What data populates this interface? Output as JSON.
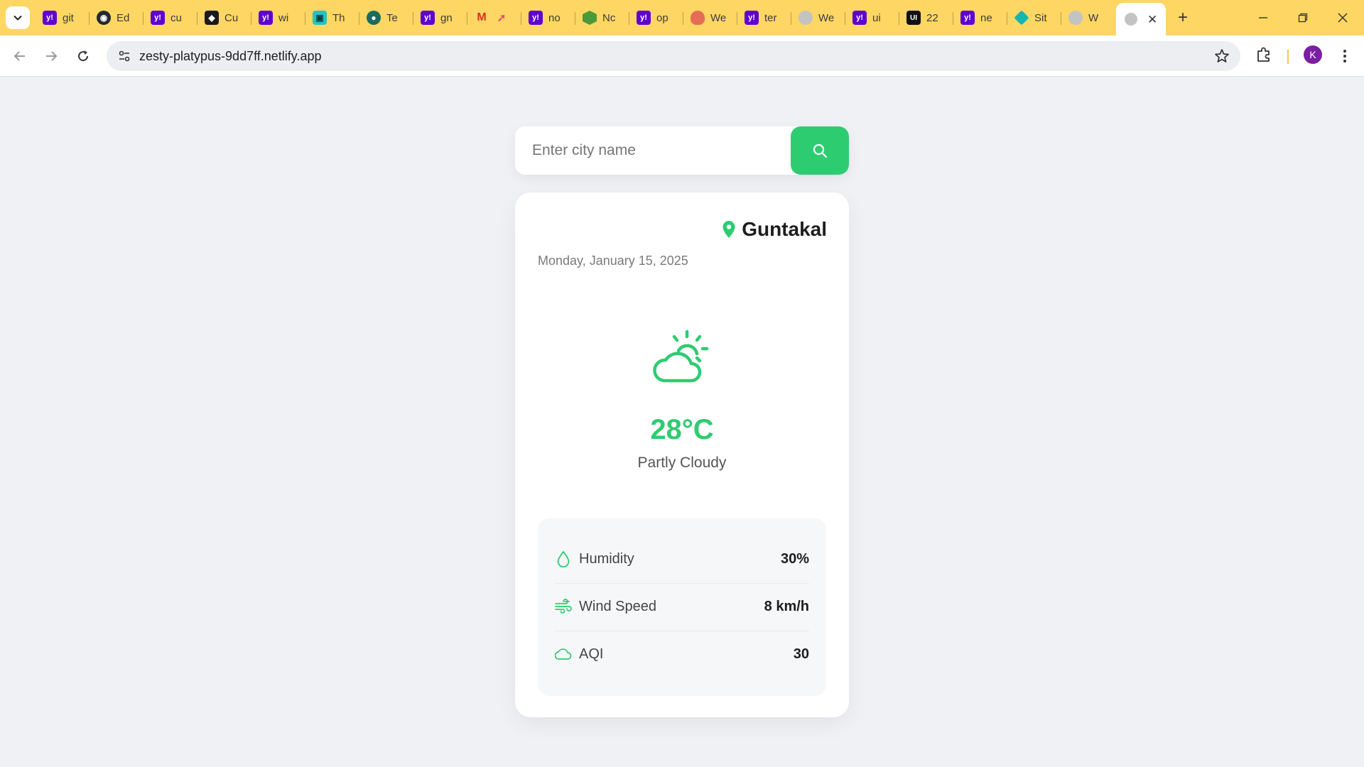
{
  "browser": {
    "tabs": [
      {
        "icon": "yahoo-icon",
        "label": "git"
      },
      {
        "icon": "github-icon",
        "label": "Ed"
      },
      {
        "icon": "yahoo-icon",
        "label": "cu"
      },
      {
        "icon": "cursor-icon",
        "label": "Cu"
      },
      {
        "icon": "yahoo-icon",
        "label": "wi"
      },
      {
        "icon": "trae-icon",
        "label": "Th"
      },
      {
        "icon": "terra-icon",
        "label": "Te"
      },
      {
        "icon": "yahoo-icon",
        "label": "gn"
      },
      {
        "icon": "gmail-icon",
        "label": ""
      },
      {
        "icon": "yahoo-icon",
        "label": "no"
      },
      {
        "icon": "node-icon",
        "label": "Nc"
      },
      {
        "icon": "yahoo-icon",
        "label": "op"
      },
      {
        "icon": "cloud-favicon-icon",
        "label": "We"
      },
      {
        "icon": "yahoo-icon",
        "label": "ter"
      },
      {
        "icon": "globe-icon",
        "label": "We"
      },
      {
        "icon": "yahoo-icon",
        "label": "ui"
      },
      {
        "icon": "uiverse-icon",
        "label": "22"
      },
      {
        "icon": "yahoo-icon",
        "label": "ne"
      },
      {
        "icon": "diamond-icon",
        "label": "Sit"
      },
      {
        "icon": "globe-icon",
        "label": "W"
      }
    ],
    "url": "zesty-platypus-9dd7ff.netlify.app",
    "profile_initial": "K",
    "tab_bar_color": "#fdd663"
  },
  "app": {
    "search": {
      "placeholder": "Enter city name",
      "value": ""
    },
    "location": {
      "city": "Guntakal",
      "date": "Monday, January 15, 2025"
    },
    "current": {
      "icon": "partly-cloudy-icon",
      "temperature": "28°C",
      "condition": "Partly Cloudy"
    },
    "details": [
      {
        "icon": "humidity-icon",
        "label": "Humidity",
        "value": "30%"
      },
      {
        "icon": "wind-icon",
        "label": "Wind Speed",
        "value": "8 km/h"
      },
      {
        "icon": "aqi-cloud-icon",
        "label": "AQI",
        "value": "30"
      }
    ],
    "accent_color": "#2ecc71"
  }
}
